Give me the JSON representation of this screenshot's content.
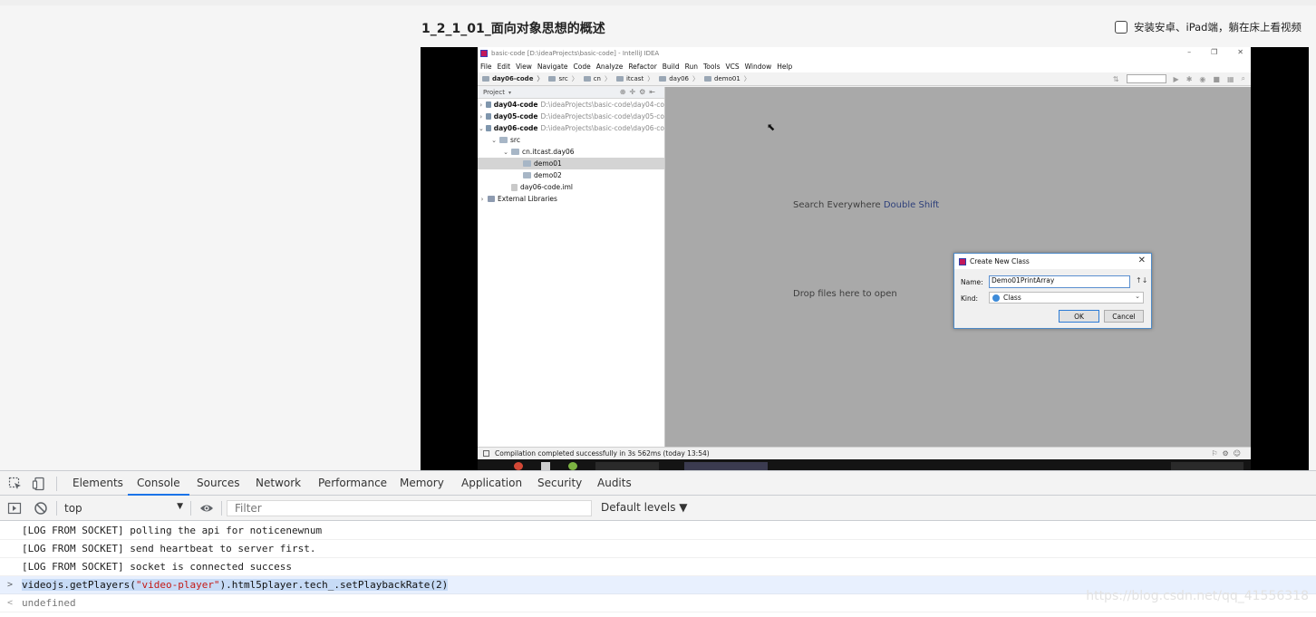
{
  "page": {
    "lesson_title": "1_2_1_01_面向对象思想的概述",
    "app_promo": "安装安卓、iPad端，躺在床上看视频"
  },
  "ide": {
    "window_title": "basic-code [D:\\ideaProjects\\basic-code] - IntelliJ IDEA",
    "menu": [
      "File",
      "Edit",
      "View",
      "Navigate",
      "Code",
      "Analyze",
      "Refactor",
      "Build",
      "Run",
      "Tools",
      "VCS",
      "Window",
      "Help"
    ],
    "breadcrumbs": [
      "day06-code",
      "src",
      "cn",
      "itcast",
      "day06",
      "demo01"
    ],
    "project_panel_title": "Project",
    "tree": [
      {
        "label": "day04-code",
        "path": "D:\\ideaProjects\\basic-code\\day04-co",
        "indent": 0,
        "arrow": "›",
        "type": "mod"
      },
      {
        "label": "day05-code",
        "path": "D:\\ideaProjects\\basic-code\\day05-co",
        "indent": 0,
        "arrow": "›",
        "type": "mod"
      },
      {
        "label": "day06-code",
        "path": "D:\\ideaProjects\\basic-code\\day06-co",
        "indent": 0,
        "arrow": "⌄",
        "type": "mod"
      },
      {
        "label": "src",
        "path": "",
        "indent": 1,
        "arrow": "⌄",
        "type": "dir"
      },
      {
        "label": "cn.itcast.day06",
        "path": "",
        "indent": 2,
        "arrow": "⌄",
        "type": "dir"
      },
      {
        "label": "demo01",
        "path": "",
        "indent": 3,
        "arrow": "",
        "type": "dir",
        "selected": true
      },
      {
        "label": "demo02",
        "path": "",
        "indent": 3,
        "arrow": "",
        "type": "dir"
      },
      {
        "label": "day06-code.iml",
        "path": "",
        "indent": 2,
        "arrow": "",
        "type": "file"
      },
      {
        "label": "External Libraries",
        "path": "",
        "indent": 0,
        "arrow": "›",
        "type": "lib"
      }
    ],
    "search_hint": "Search Everywhere",
    "search_hint_key": "Double Shift",
    "drop_hint": "Drop files here to open",
    "dialog": {
      "title": "Create New Class",
      "name_label": "Name:",
      "name_value": "Demo01PrintArray",
      "kind_label": "Kind:",
      "kind_value": "Class",
      "ok_label": "OK",
      "cancel_label": "Cancel"
    },
    "status_text": "Compilation completed successfully in 3s 562ms (today 13:54)"
  },
  "devtools": {
    "tabs": [
      "Elements",
      "Console",
      "Sources",
      "Network",
      "Performance",
      "Memory",
      "Application",
      "Security",
      "Audits"
    ],
    "active_tab": "Console",
    "context": "top",
    "filter_placeholder": "Filter",
    "levels": "Default levels ▼",
    "log": [
      {
        "kind": "log",
        "text": "[LOG FROM SOCKET] polling the api for noticenewnum"
      },
      {
        "kind": "log",
        "text": "[LOG FROM SOCKET] send heartbeat to server first."
      },
      {
        "kind": "log",
        "text": "[LOG FROM SOCKET] socket is connected success"
      }
    ],
    "input_line": {
      "prefix": "videojs.getPlayers(",
      "string_arg": "\"video-player\"",
      "suffix": ").html5player.tech_.setPlaybackRate(2)"
    },
    "result": "undefined"
  },
  "watermark": "https://blog.csdn.net/qq_41556318",
  "colors": {
    "accent": "#1a73e8",
    "ide_editor_bg": "#a9a9a9",
    "console_input_bg": "#e8f0fe"
  }
}
